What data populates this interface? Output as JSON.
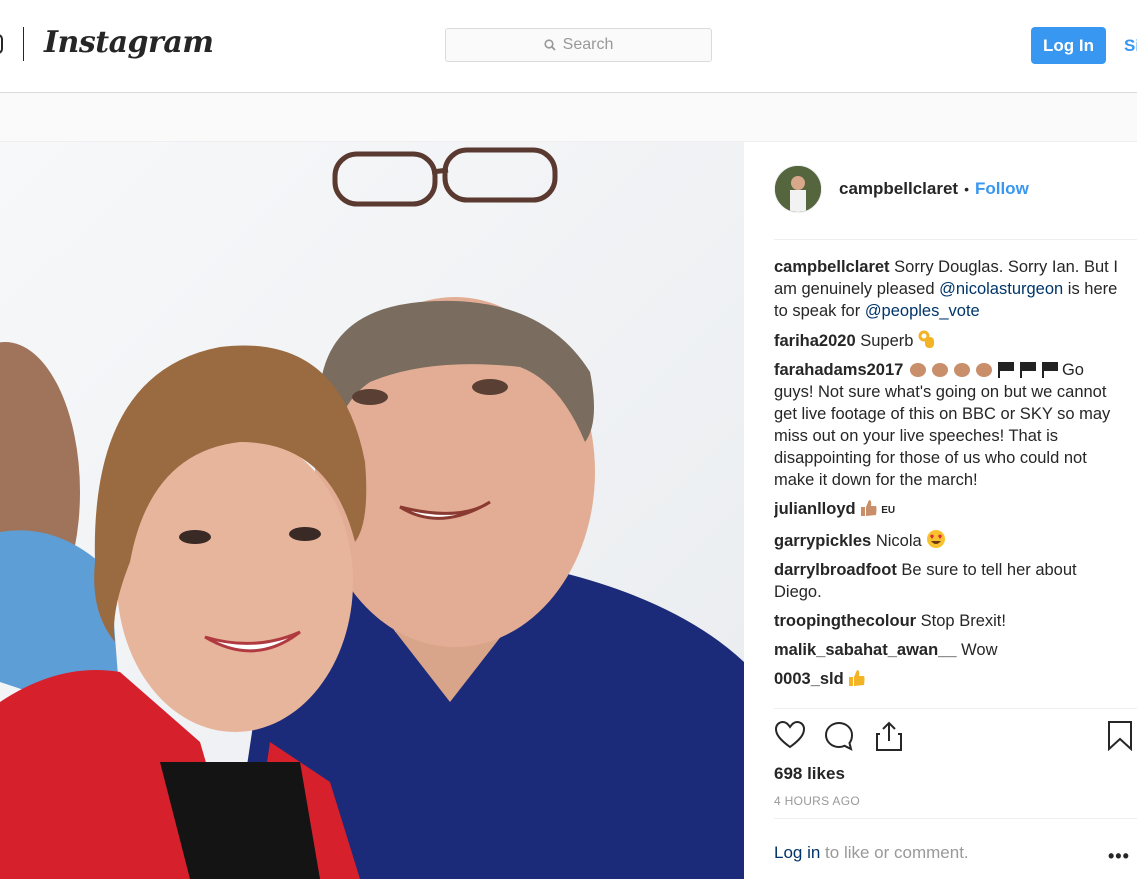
{
  "nav": {
    "brand": "Instagram",
    "search_placeholder": "Search",
    "login_label": "Log In",
    "signup_label": "Sign Up"
  },
  "post": {
    "username": "campbellclaret",
    "follow_label": "Follow",
    "likes": "698 likes",
    "timestamp": "4 HOURS AGO",
    "login_link": "Log in",
    "login_prompt": " to like or comment."
  },
  "comments": [
    {
      "user": "campbellclaret",
      "text_before": " Sorry Douglas. Sorry Ian. But I am genuinely pleased ",
      "mention1": "@nicolasturgeon",
      "text_middle": " is here to speak for ",
      "mention2": "@peoples_vote"
    },
    {
      "user": "fariha2020",
      "text": " Superb ",
      "emoji": "ok-hand-icon"
    },
    {
      "user": "farahadams2017",
      "text": "Go guys! Not sure what's going on but we cannot get live footage of this on BBC or SKY so may miss out on your live speeches! That is disappointing for those of us who could not make it down for the march!"
    },
    {
      "user": "julianlloyd",
      "badge": "EU"
    },
    {
      "user": "garrypickles",
      "text": " Nicola "
    },
    {
      "user": "darrylbroadfoot",
      "text": " Be sure to tell her about Diego."
    },
    {
      "user": "troopingthecolour",
      "text": " Stop Brexit!"
    },
    {
      "user": "malik_sabahat_awan__",
      "text": " Wow"
    },
    {
      "user": "0003_sld",
      "text": " "
    }
  ],
  "colors": {
    "accent": "#3897f0",
    "link_dark": "#003569",
    "text": "#262626",
    "muted": "#999999"
  }
}
